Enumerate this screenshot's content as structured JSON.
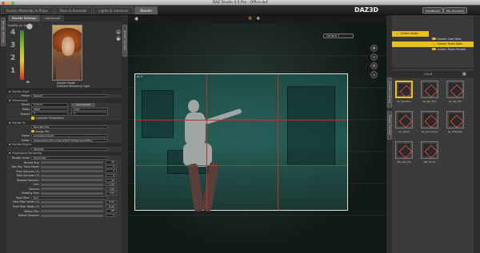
{
  "window": {
    "title": "DAZ Studio 4.5 Pro - Office.duf"
  },
  "top_tabs": [
    "Scene, Materials & Props",
    "Pose & Animate",
    "Lights & Cameras",
    "Render"
  ],
  "active_tab": "Render",
  "brand": {
    "logo": "DAZ3D",
    "btn_feedback": "Feedback",
    "btn_account": "My Account"
  },
  "render_panel": {
    "tabs": [
      "Render Settings",
      "Advanced"
    ],
    "quality_label": "Quality vs. Speed",
    "quality_numbers": [
      "4",
      "3",
      "2",
      "1"
    ],
    "sample_caption_1": "Sample Image",
    "sample_caption_2": "Software Rendering: Light",
    "rows": [
      {
        "kind": "header",
        "label": "Render Style"
      },
      {
        "kind": "field",
        "label": "Preset",
        "value": "Default"
      },
      {
        "kind": "header",
        "label": "Dimensions"
      },
      {
        "kind": "field2",
        "label": "Preset",
        "value": "Custom",
        "button": "Save Preset"
      },
      {
        "kind": "field2",
        "label": "Pixels",
        "value": "3600",
        "value2": "2161"
      },
      {
        "kind": "field2",
        "label": "Aspect",
        "value": "5",
        "value2": "3"
      },
      {
        "kind": "check",
        "label": "Constrain Proportions"
      },
      {
        "kind": "header",
        "label": "Render To"
      },
      {
        "kind": "field",
        "label": "",
        "value": "New Window"
      },
      {
        "kind": "radio",
        "label": "Image File"
      },
      {
        "kind": "field",
        "label": "Name",
        "value": "ActiveWindow.tif"
      },
      {
        "kind": "field",
        "label": "Folder",
        "value": "/Users/admin/Documents/DAZ 3D/Renders/Office"
      },
      {
        "kind": "header",
        "label": "Render Engine"
      },
      {
        "kind": "field",
        "label": "",
        "value": "3Delight"
      },
      {
        "kind": "header",
        "label": "Progressive Rendering"
      },
      {
        "kind": "field",
        "label": "Render Order",
        "value": "Horizontal"
      },
      {
        "kind": "slider",
        "label": "Bucket Size",
        "value": "16"
      },
      {
        "kind": "slider",
        "label": "Max Ray Trace Depth",
        "value": "2"
      },
      {
        "kind": "slider",
        "label": "Pixel Samples (X)",
        "value": "4"
      },
      {
        "kind": "slider",
        "label": "Pixel Samples (Y)",
        "value": "4"
      },
      {
        "kind": "slider",
        "label": "Shadow Samples",
        "value": "16"
      },
      {
        "kind": "slider",
        "label": "Gain",
        "value": "1.00"
      },
      {
        "kind": "slider",
        "label": "Gamma",
        "value": "1.00"
      },
      {
        "kind": "slider",
        "label": "Shading Rate",
        "value": "1.00"
      },
      {
        "kind": "field",
        "label": "Pixel Filter",
        "value": "Sinc"
      },
      {
        "kind": "slider",
        "label": "Pixel Filter Width (X)",
        "value": "6.00"
      },
      {
        "kind": "slider",
        "label": "Pixel Filter Width (Y)",
        "value": "6.00"
      },
      {
        "kind": "slider",
        "label": "Motion Blur",
        "value": "Off"
      },
      {
        "kind": "slider",
        "label": "Motion Samples",
        "value": "1"
      }
    ]
  },
  "viewport": {
    "camera": "Camera 1",
    "corner_label": "RC 8"
  },
  "content_panel": {
    "tree": [
      "Golden Rules",
      "Golden Cam Mats",
      "Golden Rules Mats",
      "Golden Rules Presets"
    ],
    "selected_tree": "Golden Rules Mats",
    "page_info": "1 to 8",
    "thumbs": [
      "GL_Sections",
      "GL_Spi_Tron",
      "GL_Spi_Thir",
      "GL_Spiral",
      "GL_Spi_Invers",
      "GL_Triangles",
      "NO_Del_Tria",
      "NO_Thirds"
    ],
    "selected_thumb": "GL_Sections"
  },
  "side_tabs_left": [
    "Render Settings",
    "Smart Content"
  ],
  "side_tabs_right": [
    "Content Library",
    "Smart Content"
  ]
}
